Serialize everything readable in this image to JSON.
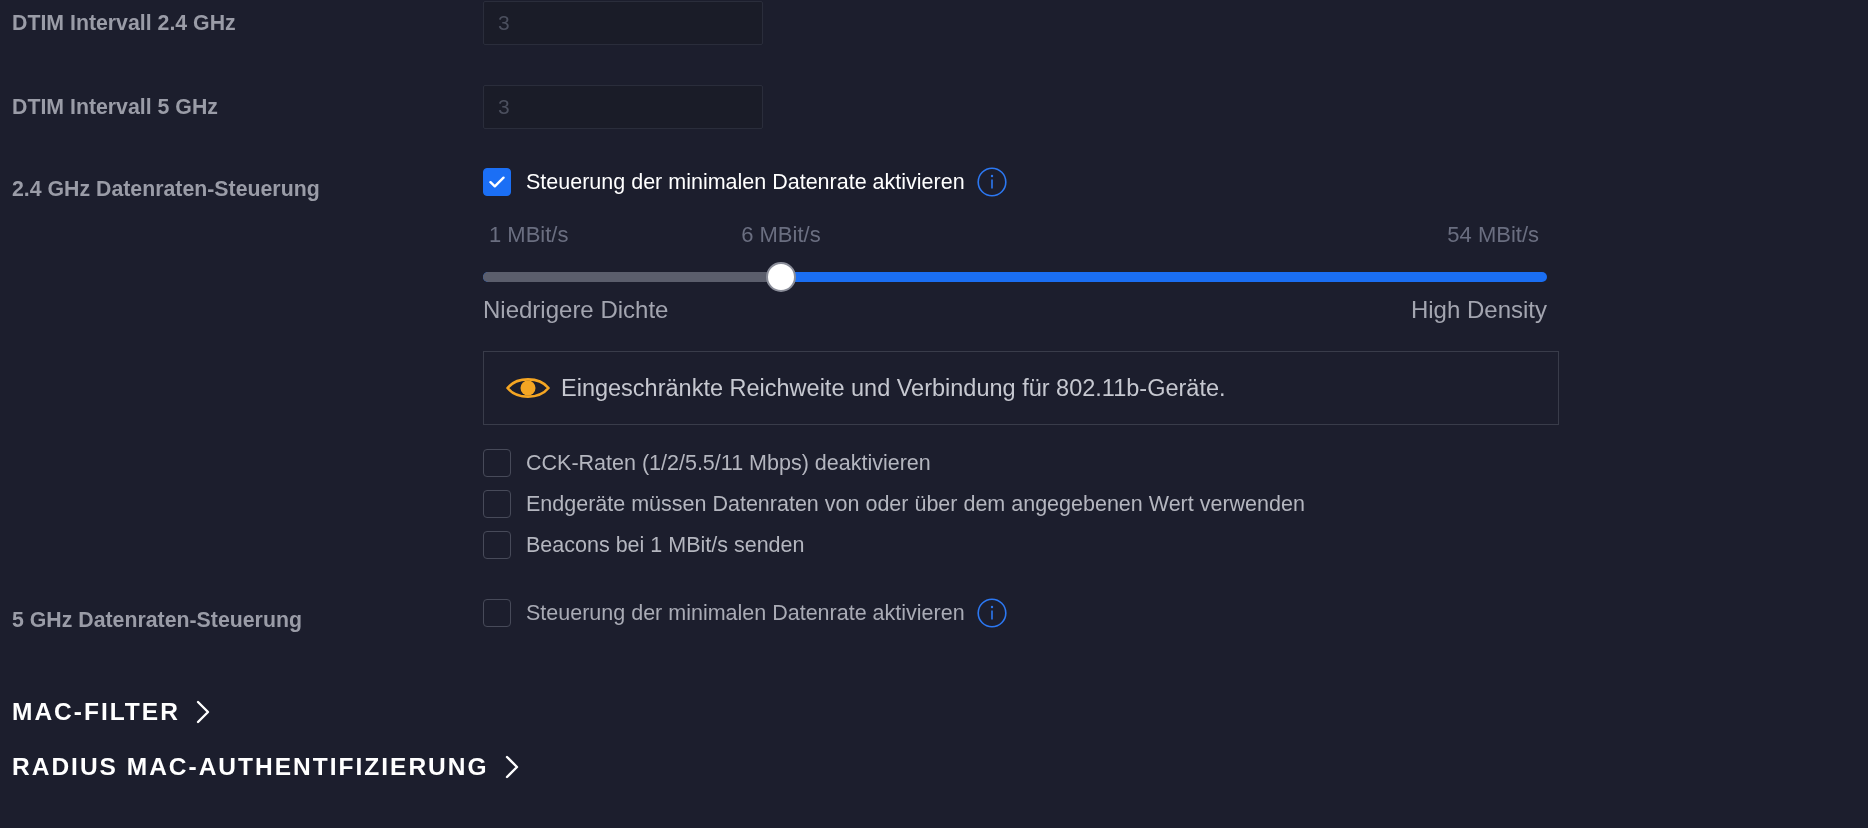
{
  "fields": [
    {
      "label": "DTIM Intervall 2.4 GHz",
      "placeholder": "3"
    },
    {
      "label": "DTIM Intervall 5 GHz",
      "placeholder": "3"
    }
  ],
  "rate_controls": [
    {
      "label": "2.4 GHz Datenraten-Steuerung",
      "toggle": {
        "text": "Steuerung der minimalen Datenrate aktivieren",
        "checked": true
      },
      "slider": {
        "min_label": "1 MBit/s",
        "value_label": "6 MBit/s",
        "max_label": "54 MBit/s",
        "level": 0.28,
        "low_label": "Niedrigere Dichte",
        "high_label": "High Density"
      },
      "notice": {
        "text": "Eingeschränkte Reichweite und Verbindung für 802.11b-Geräte."
      },
      "options": [
        {
          "text": "CCK-Raten (1/2/5.5/11 Mbps) deaktivieren",
          "checked": false
        },
        {
          "text": "Endgeräte müssen Datenraten von oder über dem angegebenen Wert verwenden",
          "checked": false
        },
        {
          "text": "Beacons bei 1 MBit/s senden",
          "checked": false
        }
      ]
    },
    {
      "label": "5 GHz Datenraten-Steuerung",
      "toggle": {
        "text": "Steuerung der minimalen Datenrate aktivieren",
        "checked": false
      }
    }
  ],
  "sections": [
    {
      "title": "MAC-FILTER"
    },
    {
      "title": "RADIUS MAC-AUTHENTIFIZIERUNG"
    }
  ]
}
